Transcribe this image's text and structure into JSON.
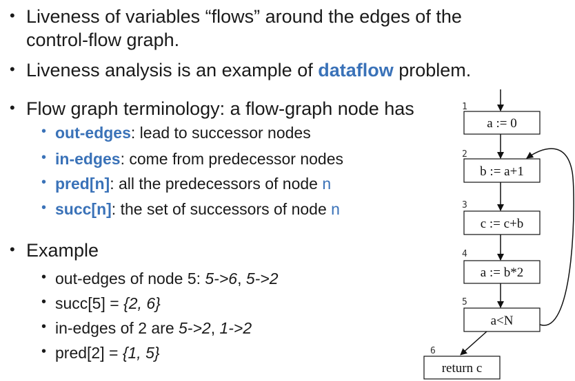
{
  "bullets": {
    "b1_line1": "Liveness of variables “flows” around the edges of the",
    "b1_line2": "control-flow graph.",
    "b2_pre": "Liveness analysis is an example of ",
    "b2_kw": "dataflow",
    "b2_post": " problem.",
    "b3": "Flow graph terminology: a flow-graph node has",
    "sub1_kw": "out-edges",
    "sub1_rest": ": lead to successor nodes",
    "sub2_kw": "in-edges",
    "sub2_rest": ": come from predecessor nodes",
    "sub3_kw": "pred[n]",
    "sub3_rest": ": all the predecessors of node ",
    "sub3_var": "n",
    "sub4_kw": "succ[n]",
    "sub4_rest": ": the set of successors of node ",
    "sub4_var": "n",
    "b4": "Example",
    "ex1_pre": "out-edges of node 5: ",
    "ex1_a": "5->6",
    "ex1_sep": ", ",
    "ex1_b": "5->2",
    "ex2_pre": "succ[5] = ",
    "ex2_val": "{2, 6}",
    "ex3_pre": "in-edges of 2 are ",
    "ex3_a": "5->2",
    "ex3_sep": ", ",
    "ex3_b": "1->2",
    "ex4_pre": "pred[2] = ",
    "ex4_val": "{1, 5}"
  },
  "graph": {
    "nodes": [
      {
        "num": "1",
        "label": "a := 0"
      },
      {
        "num": "2",
        "label": "b := a+1"
      },
      {
        "num": "3",
        "label": "c := c+b"
      },
      {
        "num": "4",
        "label": "a := b*2"
      },
      {
        "num": "5",
        "label": "a<N"
      },
      {
        "num": "6",
        "label": "return c"
      }
    ]
  },
  "colors": {
    "accent": "#3a72b8",
    "text": "#1a1a1a"
  }
}
